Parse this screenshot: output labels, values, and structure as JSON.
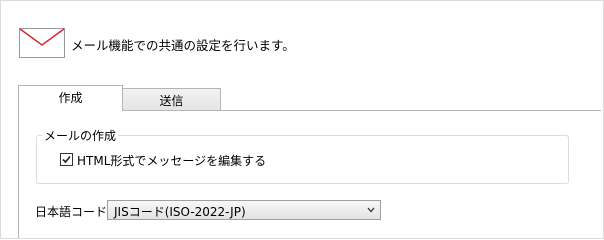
{
  "header": {
    "icon": "envelope-icon",
    "description": "メール機能での共通の設定を行います。"
  },
  "tabs": [
    {
      "label": "作成",
      "active": true
    },
    {
      "label": "送信",
      "active": false
    }
  ],
  "compose": {
    "group_title": "メールの作成",
    "html_checkbox": {
      "label": "HTML形式でメッセージを編集する",
      "checked": true
    }
  },
  "encoding": {
    "label": "日本語コード",
    "selected": "JISコード(ISO-2022-JP)"
  },
  "colors": {
    "envelope_flap": "#d9232e",
    "border": "#b5b5b5"
  }
}
